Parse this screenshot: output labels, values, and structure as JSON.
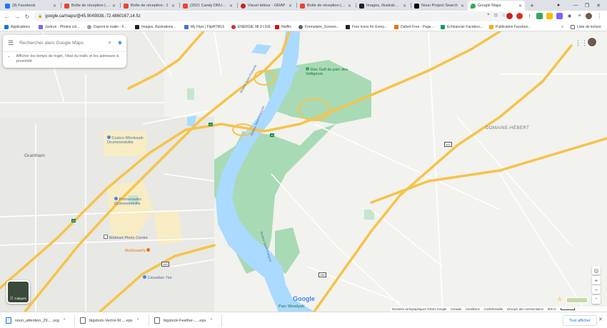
{
  "colors": {
    "tabbar": "#dee1e6",
    "water": "#aadaff",
    "park": "#a8dab5",
    "highway": "#f6c34a",
    "road": "#ffffff",
    "urban": "#e8e8e4",
    "commercial": "#f7ecc4",
    "accent": "#1a73e8"
  },
  "tabs": [
    {
      "label": "(8) Facebook",
      "icon": "facebook-icon",
      "color": "#1877f2"
    },
    {
      "label": "Boîte de réception (30",
      "icon": "gmail-icon",
      "color": "#ea4335"
    },
    {
      "label": "Boîte de réception - 1",
      "icon": "gmail-icon",
      "color": "#ea4335"
    },
    {
      "label": "(2021 Candy DRUMN",
      "icon": "gmail-icon",
      "color": "#ea4335"
    },
    {
      "label": "Visuel détour - GRAP",
      "icon": "heart-icon",
      "color": "#c5221f"
    },
    {
      "label": "Boîte de réception (76",
      "icon": "gmail-icon",
      "color": "#ea4335"
    },
    {
      "label": "Images, illustrations ir",
      "icon": "image-icon",
      "color": "#202124"
    },
    {
      "label": "Noun Project Search",
      "icon": "noun-project-icon",
      "color": "#000000"
    },
    {
      "label": "Google Maps",
      "icon": "maps-pin-icon",
      "color": "#34a853"
    }
  ],
  "new_tab": "+",
  "window_controls": {
    "minimize": "—",
    "maximize": "❐",
    "close": "✕",
    "profile": "●"
  },
  "toolbar": {
    "back": "←",
    "forward": "→",
    "reload": "↻",
    "url": "google.ca/maps/@45.9045938,-72.4860167,14.5z"
  },
  "bookmarks": {
    "apps_label": "Applications",
    "items": [
      {
        "label": "Justrun - Photos col...",
        "icon": "folder-icon",
        "color": "#7b61ff"
      },
      {
        "label": "Dupont le matin - F...",
        "icon": "radio-icon",
        "color": "#9aa0a6"
      },
      {
        "label": "Images, illustrations...",
        "icon": "image-icon",
        "color": "#202124"
      },
      {
        "label": "My Flips | FlipHTML5",
        "icon": "flip-icon",
        "color": "#3c78d8"
      },
      {
        "label": "ÉNERGIE 98.9 LIVE",
        "icon": "energie-icon",
        "color": "#d32f2f"
      },
      {
        "label": "Netflix",
        "icon": "netflix-icon",
        "color": "#e50914"
      },
      {
        "label": "Formulaire_Screeni...",
        "icon": "form-icon",
        "color": "#5f6368"
      },
      {
        "label": "Free Icons for Every...",
        "icon": "icons8-icon",
        "color": "#202124"
      },
      {
        "label": "Dafont Free - Page...",
        "icon": "dafont-icon",
        "color": "#e8710a"
      },
      {
        "label": "Echéancier Faceboo...",
        "icon": "sheets-icon",
        "color": "#0f9d58"
      },
      {
        "label": "Publication Faceboo...",
        "icon": "folder-icon",
        "color": "#f9ab00"
      }
    ],
    "more": "»",
    "reading_list": "Liste de lecture"
  },
  "search": {
    "placeholder": "Rechercher dans Google Maps",
    "commute_text": "Afficher les temps de trajet, l'état du trafic et les adresses à proximité"
  },
  "map_labels": {
    "golf": "Disc Golf du parc des Voltigeurs",
    "costco": "Costco Wholesale Drummondville",
    "promenades": "Promenades Drummondville",
    "walmart": "Walmart Photo Centre",
    "mcdonalds": "McDonald's",
    "canadian_tire": "Canadian Tire",
    "parc_woodyatt": "Parc Woodyatt",
    "domaine": "DOMAINE-HÉBERT",
    "grantham": "Grantham",
    "river1": "Rivière Saint-François",
    "river2": "Rivière Saint-François",
    "river3": "Rivière Saint-François",
    "shield_20": "20",
    "shield_55": "55",
    "shield_122": "122",
    "shield_143": "143",
    "shield_139": "139"
  },
  "map_controls": {
    "layers_label": "Calques",
    "locate": "◎",
    "zoom_in": "+",
    "zoom_out": "−",
    "pegman": "🧍"
  },
  "attribution": {
    "data": "Données cartographiques ©2021 Google",
    "country": "Canada",
    "conditions": "Conditions",
    "privacy": "Confidentialité",
    "feedback": "Envoyer des commentaires",
    "scale": "500 m",
    "logo": "Google"
  },
  "downloads": {
    "items": [
      {
        "name": "noun_attention_29.....svg"
      },
      {
        "name": "bigstock-Vector-M.....eps"
      },
      {
        "name": "bigstock-Feather-.....eps"
      }
    ],
    "show_all": "Tout afficher",
    "close": "✕"
  }
}
